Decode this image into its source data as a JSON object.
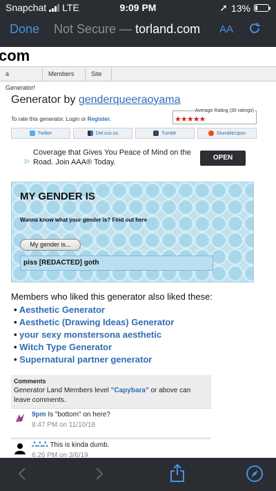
{
  "status": {
    "carrier": "Snapchat",
    "network": "LTE",
    "time": "9:09 PM",
    "battery": "13%",
    "location_icon": "location-arrow-icon"
  },
  "safari": {
    "done_label": "Done",
    "not_secure": "Not Secure —",
    "domain": "torland.com",
    "aa_label": "AA",
    "accent": "#4a90e2"
  },
  "site": {
    "logo_text": "com",
    "nav": [
      "a Generator!",
      "Members",
      "Site"
    ]
  },
  "generator": {
    "title_prefix": "Generator by",
    "author": "genderqueeraoyama",
    "rate_text": "To rate this generator, Login or",
    "register": "Register.",
    "rating_label": "Average Rating (30 ratings)",
    "rating_stars": "★★★★★",
    "share": [
      "Twitter",
      "Del.icio.us",
      "Tumblr",
      "StumbleUpon"
    ]
  },
  "ad": {
    "text": "Coverage that Gives You Peace of Mind on the Road. Join AAA® Today.",
    "cta": "OPEN"
  },
  "widget": {
    "heading": "MY GENDER IS",
    "question": "Wanna know what your gender is? Find out here",
    "button": "My gender is...",
    "result": "piss [REDACTED] goth"
  },
  "also_liked": {
    "heading": "Members who liked this generator also liked these:",
    "items": [
      "Aesthetic Generator",
      "Aesthetic (Drawing Ideas) Generator",
      "your sexy monstersona aesthetic",
      "Witch Type Generator",
      "Supernatural partner generator"
    ]
  },
  "comments": {
    "heading": "Comments",
    "info_prefix": "Generator Land Members level",
    "level": "\"Capybara\"",
    "info_suffix": "or above can leave comments.",
    "list": [
      {
        "user": "9pm",
        "text": "Is \"bottom\" on here?",
        "date": "8:47 PM on 11/10/18"
      },
      {
        "user": "ஃஃஃ",
        "text": "This is kinda dumb.",
        "date": "6:26 PM on 3/6/19"
      }
    ]
  }
}
